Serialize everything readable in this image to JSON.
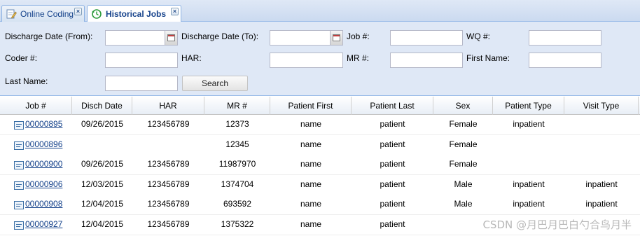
{
  "tabs": [
    {
      "label": "Online Coding",
      "icon": "edit-document-icon",
      "active": false
    },
    {
      "label": "Historical Jobs",
      "icon": "history-clock-icon",
      "active": true
    }
  ],
  "filters": {
    "discharge_from_label": "Discharge Date (From):",
    "discharge_to_label": "Discharge Date (To):",
    "job_label": "Job #:",
    "wq_label": "WQ #:",
    "coder_label": "Coder #:",
    "har_label": "HAR:",
    "mr_label": "MR #:",
    "first_name_label": "First Name:",
    "last_name_label": "Last Name:",
    "search_label": "Search",
    "values": {
      "discharge_from": "",
      "discharge_to": "",
      "job": "",
      "wq": "",
      "coder": "",
      "har": "",
      "mr": "",
      "first_name": "",
      "last_name": ""
    }
  },
  "grid": {
    "columns": [
      "Job #",
      "Disch Date",
      "HAR",
      "MR #",
      "Patient First",
      "Patient Last",
      "Sex",
      "Patient Type",
      "Visit Type"
    ],
    "rows": [
      {
        "job": "00000895",
        "disch": "09/26/2015",
        "har": "123456789",
        "mr": "12373",
        "first": "name",
        "last": "patient",
        "sex": "Female",
        "ptype": "inpatient",
        "vtype": ""
      },
      {
        "job": "00000896",
        "disch": "",
        "har": "",
        "mr": "12345",
        "first": "name",
        "last": "patient",
        "sex": "Female",
        "ptype": "",
        "vtype": ""
      },
      {
        "job": "00000900",
        "disch": "09/26/2015",
        "har": "123456789",
        "mr": "11987970",
        "first": "name",
        "last": "patient",
        "sex": "Female",
        "ptype": "",
        "vtype": ""
      },
      {
        "job": "00000906",
        "disch": "12/03/2015",
        "har": "123456789",
        "mr": "1374704",
        "first": "name",
        "last": "patient",
        "sex": "Male",
        "ptype": "inpatient",
        "vtype": "inpatient"
      },
      {
        "job": "00000908",
        "disch": "12/04/2015",
        "har": "123456789",
        "mr": "693592",
        "first": "name",
        "last": "patient",
        "sex": "Male",
        "ptype": "inpatient",
        "vtype": "inpatient"
      },
      {
        "job": "00000927",
        "disch": "12/04/2015",
        "har": "123456789",
        "mr": "1375322",
        "first": "name",
        "last": "patient",
        "sex": "",
        "ptype": "",
        "vtype": ""
      }
    ]
  },
  "watermark": "CSDN @月巴月巴白勺合鸟月半",
  "colors": {
    "header_bg": "#dfe8f6",
    "link": "#15428b",
    "border": "#99bbe8"
  }
}
